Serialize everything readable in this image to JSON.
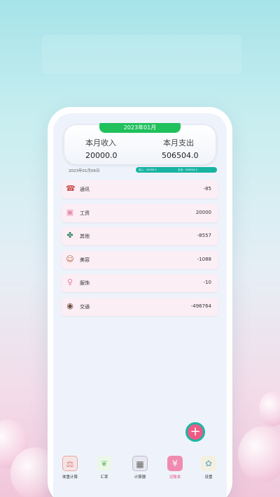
{
  "summary": {
    "month": "2023年01月",
    "income_label": "本月收入",
    "income_value": "20000.0",
    "expense_label": "本月支出",
    "expense_value": "506504.0"
  },
  "date": "2023年01月06日",
  "bar": {
    "income_text": "收入：20000.0",
    "expense_text": "支出：506504.0"
  },
  "records": [
    {
      "icon": "phone-icon",
      "name": "通讯",
      "amount": "-85"
    },
    {
      "icon": "wallet-icon",
      "name": "工资",
      "amount": "20000"
    },
    {
      "icon": "clover-icon",
      "name": "其他",
      "amount": "-8557"
    },
    {
      "icon": "face-icon",
      "name": "美容",
      "amount": "-1088"
    },
    {
      "icon": "dress-icon",
      "name": "服饰",
      "amount": "-10"
    },
    {
      "icon": "car-icon",
      "name": "交通",
      "amount": "-496764"
    }
  ],
  "fab_label": "+",
  "tabs": [
    {
      "label": "体重计算",
      "icon": "scale-icon"
    },
    {
      "label": "汇率",
      "icon": "leaf-icon"
    },
    {
      "label": "计算器",
      "icon": "calculator-icon"
    },
    {
      "label": "记账本",
      "icon": "ledger-icon",
      "active": true
    },
    {
      "label": "设置",
      "icon": "gear-icon"
    }
  ],
  "colors": {
    "accent_green": "#20c05c",
    "teal": "#18b3a3",
    "pink": "#ec5a86",
    "item_bg": "#fbeef4"
  }
}
